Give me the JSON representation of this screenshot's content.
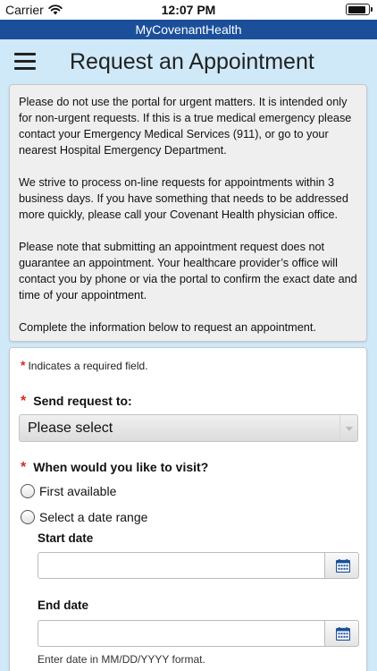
{
  "status_bar": {
    "carrier": "Carrier",
    "time": "12:07 PM"
  },
  "app_bar": {
    "title": "MyCovenantHealth"
  },
  "header": {
    "title": "Request an Appointment"
  },
  "info": {
    "paragraphs": [
      "Please do not use the portal for urgent matters. It is intended only for non-urgent requests. If this is a true medical emergency please contact your Emergency Medical Services (911), or go to your nearest Hospital Emergency Department.",
      "We strive to process on-line requests for appointments within 3 business days. If you have something that needs to be addressed more quickly, please call your Covenant Health physician office.",
      "Please note that submitting an appointment request does not guarantee an appointment. Your healthcare provider’s office will contact you by phone or via the portal to confirm the exact date and time of your appointment.",
      "Complete the information below to request an appointment."
    ]
  },
  "form": {
    "required_star": "*",
    "required_note": "Indicates a required field.",
    "send_to": {
      "label": "Send request to:",
      "selected": "Please select"
    },
    "visit": {
      "label": "When would you like to visit?",
      "options": [
        "First available",
        "Select a date range"
      ]
    },
    "start_date": {
      "label": "Start date",
      "value": ""
    },
    "end_date": {
      "label": "End date",
      "value": ""
    },
    "date_hint": "Enter date in MM/DD/YYYY format."
  }
}
